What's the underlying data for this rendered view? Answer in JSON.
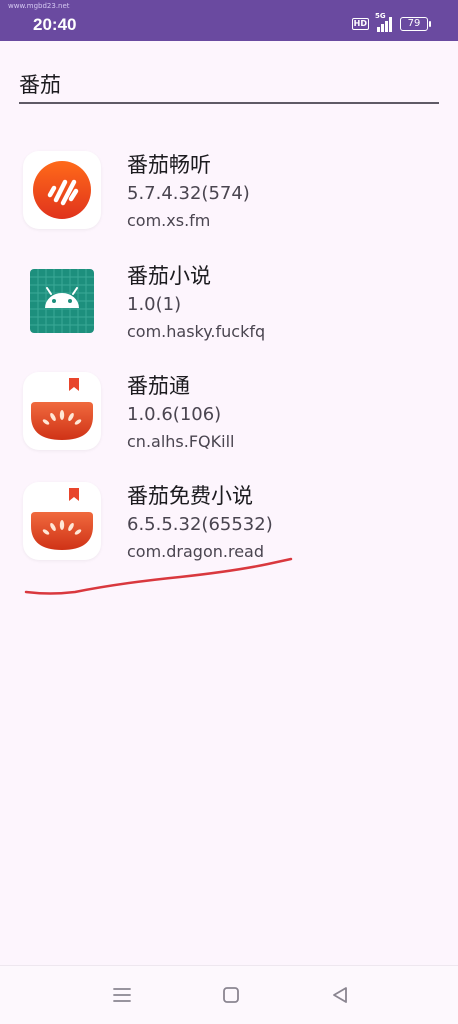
{
  "status_bar": {
    "watermark": "www.mgbd23.net",
    "time": "20:40",
    "hd_badge": "HD",
    "network": "5G",
    "battery": "79"
  },
  "search": {
    "value": "番茄"
  },
  "apps": [
    {
      "name": "番茄畅听",
      "version": "5.7.4.32(574)",
      "package": "com.xs.fm",
      "icon": "tomato-listen-app-icon"
    },
    {
      "name": "番茄小说",
      "version": "1.0(1)",
      "package": "com.hasky.fuckfq",
      "icon": "android-robot-app-icon"
    },
    {
      "name": "番茄通",
      "version": "1.0.6(106)",
      "package": "cn.alhs.FQKill",
      "icon": "tomato-bookmark-app-icon"
    },
    {
      "name": "番茄免费小说",
      "version": "6.5.5.32(65532)",
      "package": "com.dragon.read",
      "icon": "tomato-bookmark-app-icon"
    }
  ],
  "annotation_color": "#d9383e",
  "nav": {
    "recents_icon": "menu-icon",
    "home_icon": "home-square-icon",
    "back_icon": "back-triangle-icon"
  }
}
